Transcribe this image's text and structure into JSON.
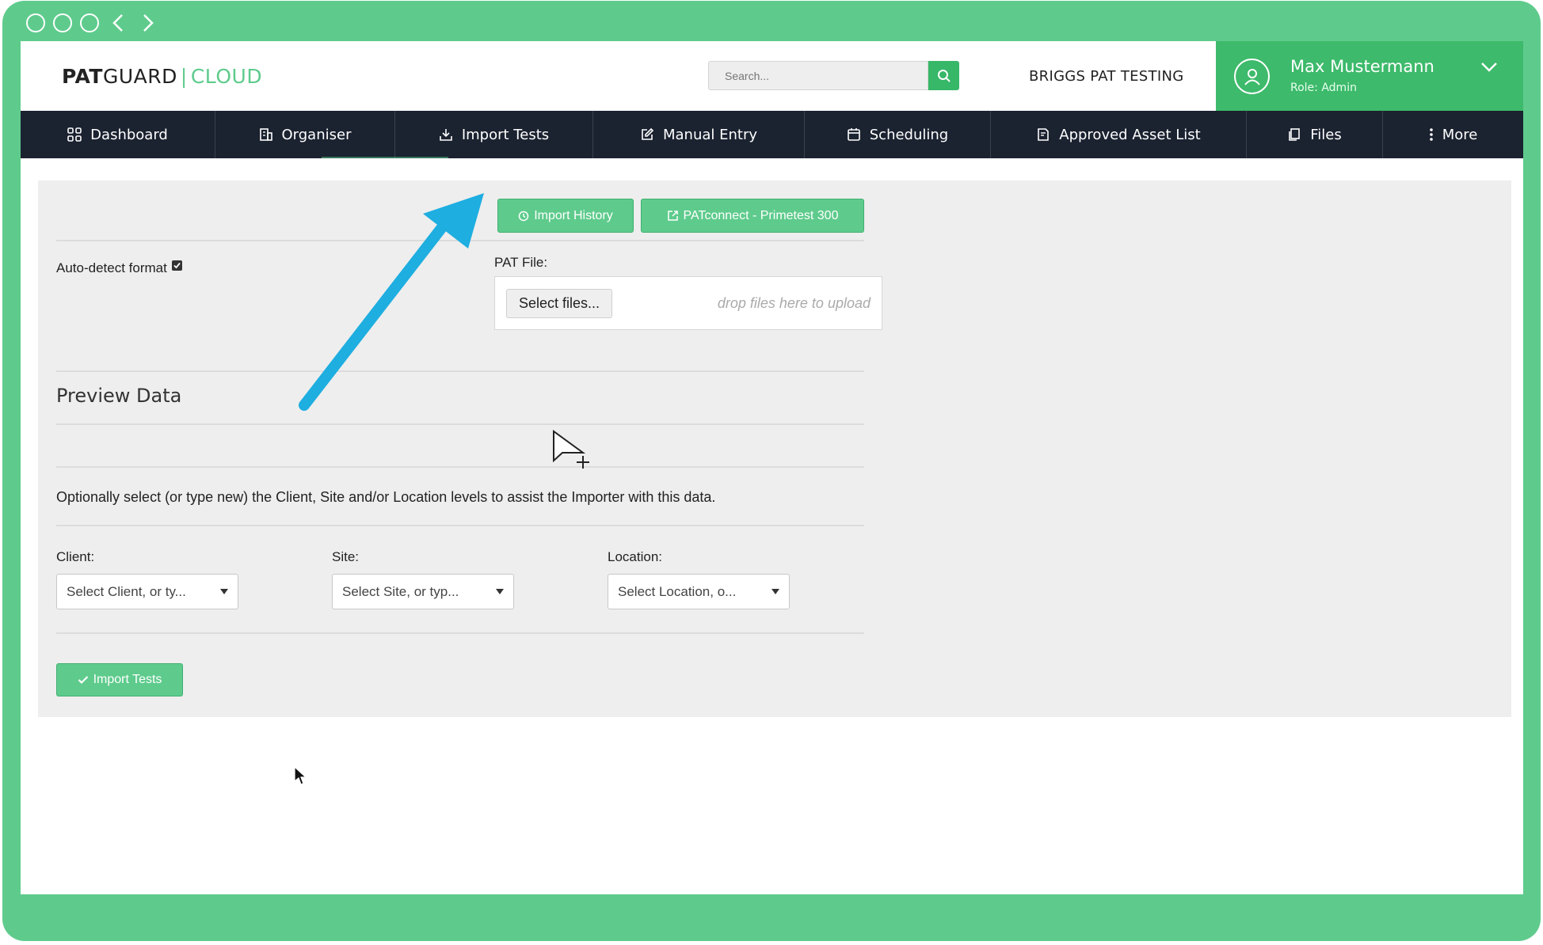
{
  "header": {
    "logo_bold": "PAT",
    "logo_rest": "GUARD",
    "logo_sep": "|",
    "logo_cloud": "CLOUD",
    "search_placeholder": "Search...",
    "org_name": "BRIGGS PAT TESTING",
    "user_name": "Max Mustermann",
    "user_role": "Role: Admin"
  },
  "nav": {
    "items": [
      {
        "label": "Dashboard",
        "icon": "grid-icon"
      },
      {
        "label": "Organiser",
        "icon": "building-icon"
      },
      {
        "label": "Import Tests",
        "icon": "download-icon"
      },
      {
        "label": "Manual Entry",
        "icon": "edit-icon"
      },
      {
        "label": "Scheduling",
        "icon": "calendar-icon"
      },
      {
        "label": "Approved Asset List",
        "icon": "document-icon"
      },
      {
        "label": "Files",
        "icon": "files-icon"
      },
      {
        "label": "More",
        "icon": "more-vertical-icon"
      }
    ]
  },
  "import": {
    "history_label": "Import History",
    "patconnect_label": "PATconnect - Primetest 300",
    "autodetect_label": "Auto-detect format",
    "autodetect_checked": true,
    "pat_file_label": "PAT File:",
    "select_files_label": "Select files...",
    "drop_hint": "drop files here to upload",
    "preview_heading": "Preview Data",
    "info_text": "Optionally select (or type new) the Client, Site and/or Location levels to assist the Importer with this data.",
    "client_label": "Client:",
    "client_placeholder": "Select Client, or ty...",
    "site_label": "Site:",
    "site_placeholder": "Select Site, or typ...",
    "location_label": "Location:",
    "location_placeholder": "Select Location, o...",
    "import_button_label": "Import Tests"
  },
  "colors": {
    "frame": "#5ecb8c",
    "accent": "#3dba6b",
    "nav_bg": "#1b2230",
    "annotation_arrow": "#1eaee0"
  }
}
